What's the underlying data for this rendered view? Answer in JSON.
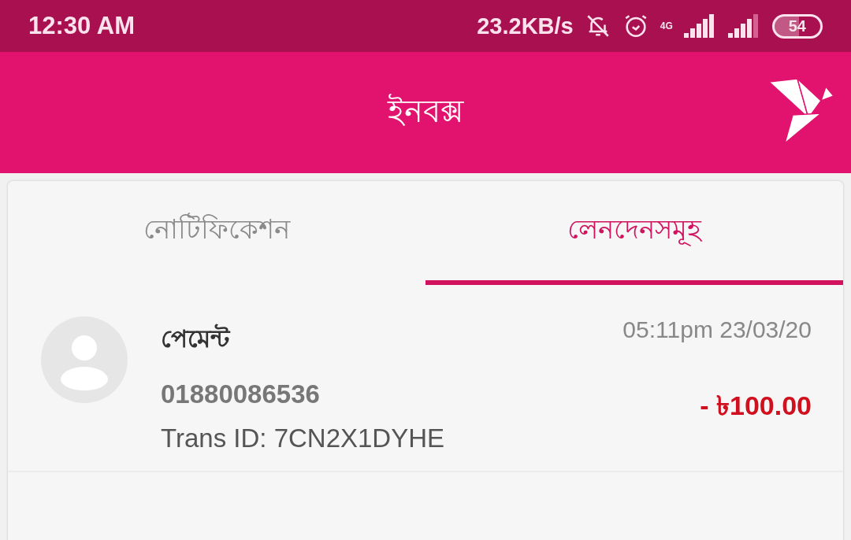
{
  "status_bar": {
    "time": "12:30 AM",
    "speed": "23.2KB/s",
    "network": "4G",
    "battery": "54"
  },
  "header": {
    "title": "ইনবক্স"
  },
  "tabs": [
    {
      "label": "নোটিফিকেশন",
      "selected": false
    },
    {
      "label": "লেনদেনসমূহ",
      "selected": true
    }
  ],
  "transactions": [
    {
      "type": "পেমেন্ট",
      "time": "05:11pm 23/03/20",
      "number": "01880086536",
      "trans_id": "Trans ID: 7CN2X1DYHE",
      "amount": "- ৳100.00"
    }
  ]
}
